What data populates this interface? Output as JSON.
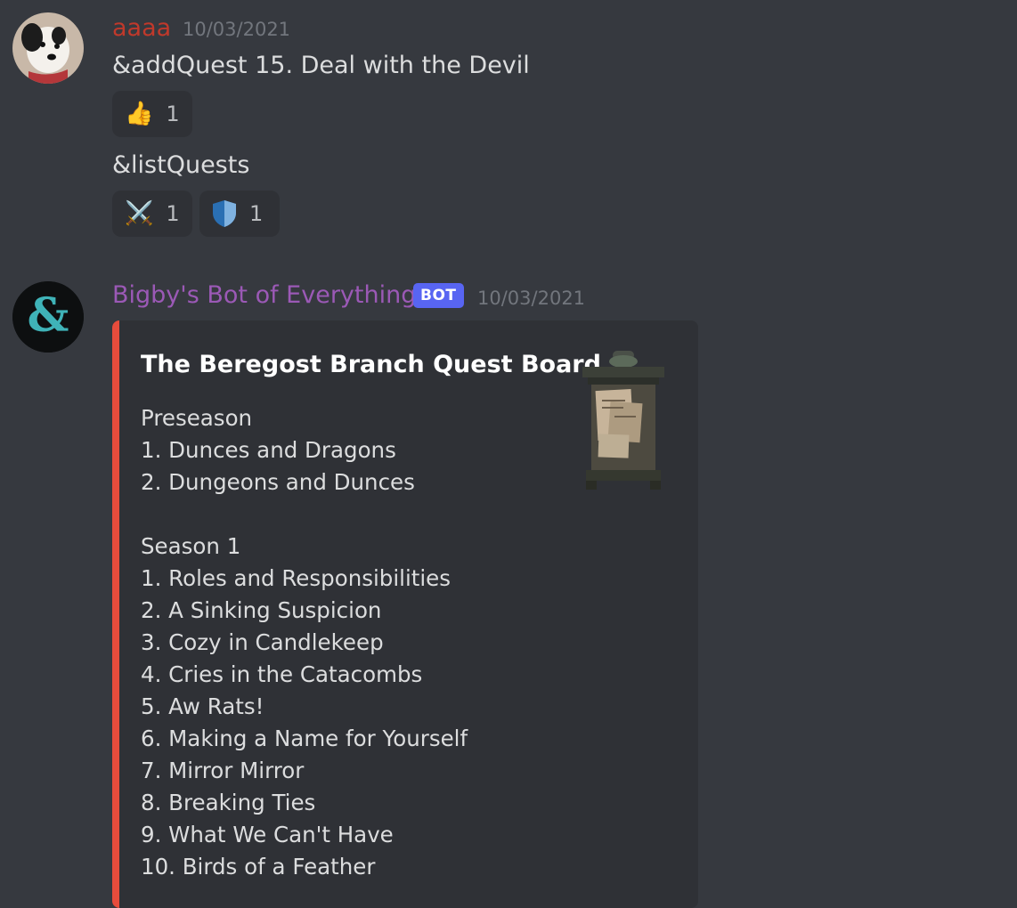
{
  "message1": {
    "username": "aaaa",
    "username_color": "#c0392b",
    "timestamp": "10/03/2021",
    "lines": [
      {
        "text": "&addQuest 15. Deal with the Devil",
        "reactions": [
          {
            "icon": "thumbs-up-icon",
            "emoji": "👍",
            "count": "1"
          }
        ]
      },
      {
        "text": "&listQuests",
        "reactions": [
          {
            "icon": "crossed-swords-icon",
            "emoji": "⚔️",
            "count": "1"
          },
          {
            "icon": "shield-icon",
            "emoji": "🛡",
            "count": "1"
          }
        ]
      }
    ]
  },
  "message2": {
    "username": "Bigby's Bot of Everything",
    "username_color": "#9b59b6",
    "bot_tag": "BOT",
    "timestamp": "10/03/2021",
    "embed": {
      "accent_color": "#e74c3c",
      "title": "The Beregost Branch Quest Board",
      "thumbnail": "quest-board-icon",
      "lines": [
        "Preseason",
        "1. Dunces and Dragons",
        "2. Dungeons and Dunces",
        "",
        "Season 1",
        "1. Roles and Responsibilities",
        "2. A Sinking Suspicion",
        "3. Cozy in Candlekeep",
        "4. Cries in the Catacombs",
        "5. Aw Rats!",
        "6. Making a Name for Yourself",
        "7. Mirror Mirror",
        "8. Breaking Ties",
        "9. What We Can't Have",
        "10. Birds of a Feather"
      ]
    }
  },
  "colors": {
    "background": "#36393f",
    "embed_bg": "#2f3136",
    "bot_tag_bg": "#5865f2"
  }
}
